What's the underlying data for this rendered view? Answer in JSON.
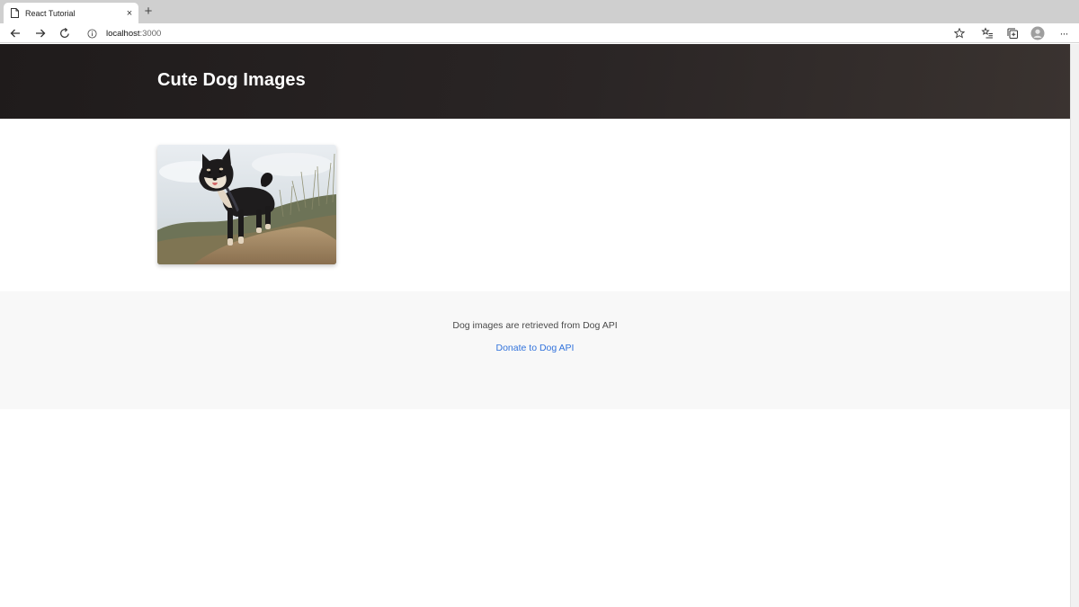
{
  "browser": {
    "tab": {
      "title": "React Tutorial",
      "close_glyph": "×"
    },
    "new_tab_glyph": "+",
    "address_bar": {
      "host": "localhost",
      "port": ":3000"
    },
    "toolbar_icons": [
      "back-icon",
      "forward-icon",
      "refresh-icon",
      "info-icon",
      "star-icon",
      "favorites-icon",
      "collections-icon",
      "profile-icon",
      "more-icon"
    ],
    "more_glyph": "···"
  },
  "page": {
    "hero": {
      "title": "Cute Dog Images",
      "background": "#231f1f"
    },
    "gallery": [
      {
        "subject": "shiba-inu dog photo"
      }
    ],
    "footer": {
      "text": "Dog images are retrieved from Dog API",
      "link_label": "Donate to Dog API",
      "link_color": "#3273dc",
      "background": "#f8f8f8"
    }
  }
}
